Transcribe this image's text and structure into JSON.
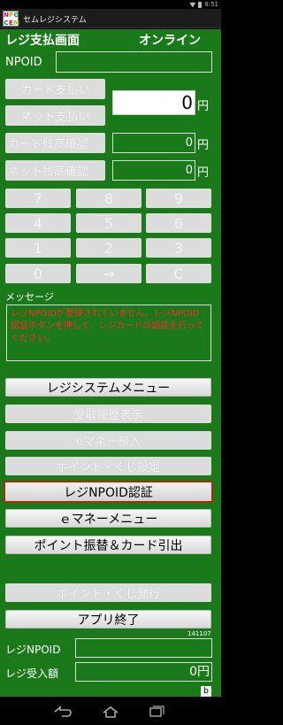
{
  "status_bar": {
    "time": "8:51",
    "icons": [
      "wifi-icon",
      "battery-icon"
    ]
  },
  "titlebar": {
    "logo_letters": [
      "N",
      "P",
      "O",
      "C",
      "E",
      "M"
    ],
    "app_title": "セムレジシステム"
  },
  "screen": {
    "heading": "レジ支払画面",
    "connection_status": "オンライン",
    "npoid_label": "NPOID",
    "npoid_value": "",
    "card_payment_button": "カード支払い",
    "net_payment_button": "ネット支払い",
    "amount_value": "0",
    "yen_unit": "円",
    "card_balance_button": "カード残高確認",
    "card_balance_value": "0",
    "net_balance_button": "ネット残高確認",
    "net_balance_value": "0",
    "keypad": [
      "7",
      "8",
      "9",
      "4",
      "5",
      "6",
      "1",
      "2",
      "3",
      "0",
      "→",
      "C"
    ],
    "message_label": "メッセージ",
    "message_text": "レジNPOIDが登録されていません。レジNPOID認証ボタンを押して、レジカードの認証を行ってください。",
    "menu": {
      "register_system_menu": "レジシステムメニュー",
      "receipt_history": "受取履歴表示",
      "emoney_deposit": "eマネー預入",
      "point_lottery_settings": "ポイント・くじ設定",
      "register_npoid_auth": "レジNPOID認証",
      "emoney_menu": "ｅマネーメニュー",
      "point_transfer": "ポイント振替＆カード引出",
      "point_lottery_issue": "ポイント・くじ発行",
      "app_exit": "アプリ終了"
    },
    "version": "141107",
    "register_npoid_label": "レジNPOID",
    "register_npoid_value": "",
    "register_received_label": "レジ受入額",
    "register_received_value": "0円",
    "badge": "b"
  },
  "colors": {
    "background": "#1a7a1a",
    "message_text": "#ff2a2a",
    "selected_border": "#b82800",
    "disabled_button": "#dcdcdc"
  }
}
